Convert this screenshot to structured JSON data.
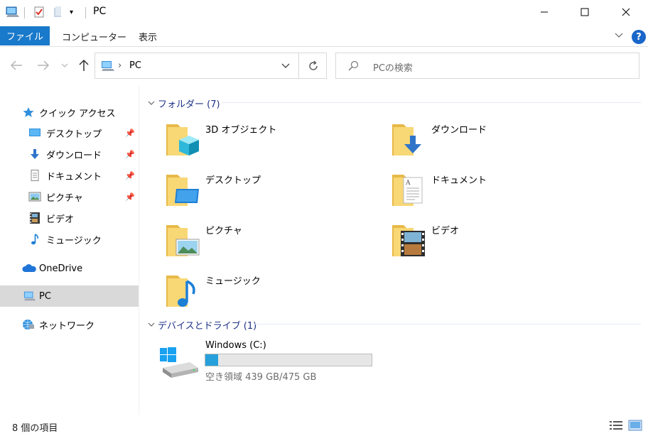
{
  "window": {
    "title": "PC"
  },
  "ribbon": {
    "tabs": [
      "ファイル",
      "コンピューター",
      "表示"
    ]
  },
  "address": {
    "path": "PC",
    "separator": "›"
  },
  "search": {
    "placeholder": "PCの検索"
  },
  "sidebar": {
    "items": [
      {
        "label": "クイック アクセス",
        "icon": "star-icon"
      },
      {
        "label": "デスクトップ",
        "icon": "desktop-icon",
        "pinned": true
      },
      {
        "label": "ダウンロード",
        "icon": "download-icon",
        "pinned": true
      },
      {
        "label": "ドキュメント",
        "icon": "document-icon",
        "pinned": true
      },
      {
        "label": "ピクチャ",
        "icon": "pictures-icon",
        "pinned": true
      },
      {
        "label": "ビデオ",
        "icon": "video-icon"
      },
      {
        "label": "ミュージック",
        "icon": "music-icon"
      },
      {
        "label": "OneDrive",
        "icon": "cloud-icon"
      },
      {
        "label": "PC",
        "icon": "computer-icon",
        "selected": true
      },
      {
        "label": "ネットワーク",
        "icon": "network-icon"
      }
    ]
  },
  "content": {
    "folders_header": "フォルダー (7)",
    "folders": [
      {
        "name": "3D オブジェクト",
        "icon": "3d-objects-icon"
      },
      {
        "name": "ダウンロード",
        "icon": "download-folder-icon"
      },
      {
        "name": "デスクトップ",
        "icon": "desktop-folder-icon"
      },
      {
        "name": "ドキュメント",
        "icon": "documents-folder-icon"
      },
      {
        "name": "ピクチャ",
        "icon": "pictures-folder-icon"
      },
      {
        "name": "ビデオ",
        "icon": "videos-folder-icon"
      },
      {
        "name": "ミュージック",
        "icon": "music-folder-icon"
      }
    ],
    "devices_header": "デバイスとドライブ (1)",
    "drives": [
      {
        "name": "Windows (C:)",
        "free_text": "空き領域 439 GB/475 GB",
        "used_fraction": 0.076
      }
    ]
  },
  "status": {
    "item_count": "8 個の項目"
  },
  "colors": {
    "accent": "#1979ca",
    "header_text": "#1e3287",
    "folder_yellow": "#f8d775",
    "drive_bar": "#26a0da"
  }
}
